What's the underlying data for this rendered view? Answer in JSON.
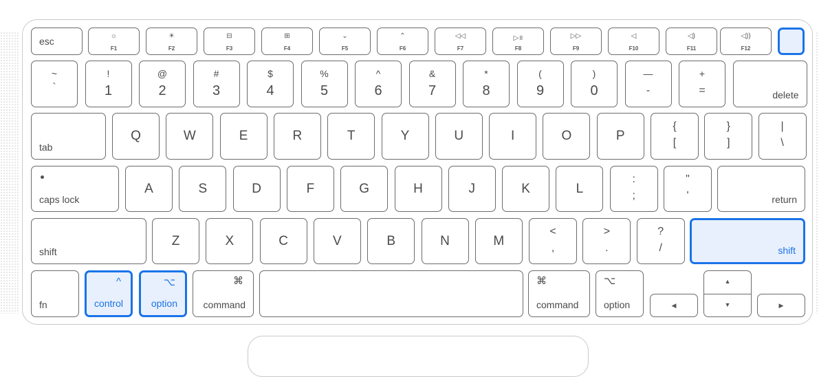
{
  "colors": {
    "accent": "#1a73e8",
    "accent_fill": "#e8f0fd",
    "key_border": "#6b6b6b",
    "text": "#4a4a4a"
  },
  "function_row": [
    {
      "id": "esc",
      "label": "esc"
    },
    {
      "id": "f1",
      "icon": "☼",
      "label": "F1",
      "icon_name": "brightness-down-icon"
    },
    {
      "id": "f2",
      "icon": "☀",
      "label": "F2",
      "icon_name": "brightness-up-icon"
    },
    {
      "id": "f3",
      "icon": "⊟",
      "label": "F3",
      "icon_name": "mission-control-icon"
    },
    {
      "id": "f4",
      "icon": "⊞",
      "label": "F4",
      "icon_name": "launchpad-icon"
    },
    {
      "id": "f5",
      "icon": "⌄",
      "label": "F5",
      "icon_name": "keyboard-backlight-down-icon"
    },
    {
      "id": "f6",
      "icon": "⌃",
      "label": "F6",
      "icon_name": "keyboard-backlight-up-icon"
    },
    {
      "id": "f7",
      "icon": "◁◁",
      "label": "F7",
      "icon_name": "rewind-icon"
    },
    {
      "id": "f8",
      "icon": "▷॥",
      "label": "F8",
      "icon_name": "play-pause-icon"
    },
    {
      "id": "f9",
      "icon": "▷▷",
      "label": "F9",
      "icon_name": "fast-forward-icon"
    },
    {
      "id": "f10",
      "icon": "◁",
      "label": "F10",
      "icon_name": "mute-icon"
    },
    {
      "id": "f11",
      "icon": "◁)",
      "label": "F11",
      "icon_name": "volume-down-icon"
    },
    {
      "id": "f12",
      "icon": "◁))",
      "label": "F12",
      "icon_name": "volume-up-icon"
    },
    {
      "id": "power",
      "label": "",
      "selected": true
    }
  ],
  "number_row": [
    {
      "top": "~",
      "bottom": "`"
    },
    {
      "top": "!",
      "bottom": "1"
    },
    {
      "top": "@",
      "bottom": "2"
    },
    {
      "top": "#",
      "bottom": "3"
    },
    {
      "top": "$",
      "bottom": "4"
    },
    {
      "top": "%",
      "bottom": "5"
    },
    {
      "top": "^",
      "bottom": "6"
    },
    {
      "top": "&",
      "bottom": "7"
    },
    {
      "top": "*",
      "bottom": "8"
    },
    {
      "top": "(",
      "bottom": "9"
    },
    {
      "top": ")",
      "bottom": "0"
    },
    {
      "top": "—",
      "bottom": "-"
    },
    {
      "top": "+",
      "bottom": "="
    },
    {
      "label": "delete"
    }
  ],
  "qwerty_row": {
    "tab": "tab",
    "letters": [
      "Q",
      "W",
      "E",
      "R",
      "T",
      "Y",
      "U",
      "I",
      "O",
      "P"
    ],
    "punct": [
      {
        "top": "{",
        "bottom": "["
      },
      {
        "top": "}",
        "bottom": "]"
      },
      {
        "top": "|",
        "bottom": "\\"
      }
    ]
  },
  "home_row": {
    "caps": "caps lock",
    "letters": [
      "A",
      "S",
      "D",
      "F",
      "G",
      "H",
      "J",
      "K",
      "L"
    ],
    "punct": [
      {
        "top": ":",
        "bottom": ";"
      },
      {
        "top": "\"",
        "bottom": "'"
      }
    ],
    "return": "return"
  },
  "bottom_letter_row": {
    "shift_left": "shift",
    "letters": [
      "Z",
      "X",
      "C",
      "V",
      "B",
      "N",
      "M"
    ],
    "punct": [
      {
        "top": "<",
        "bottom": ","
      },
      {
        "top": ">",
        "bottom": "."
      },
      {
        "top": "?",
        "bottom": "/"
      }
    ],
    "shift_right": "shift",
    "shift_right_selected": true
  },
  "modifier_row": {
    "fn": "fn",
    "control": {
      "symbol": "^",
      "label": "control",
      "selected": true
    },
    "option_left": {
      "symbol": "⌥",
      "label": "option",
      "selected": true
    },
    "command_left": {
      "symbol": "⌘",
      "label": "command"
    },
    "space": "",
    "command_right": {
      "symbol": "⌘",
      "label": "command"
    },
    "option_right": {
      "symbol": "⌥",
      "label": "option"
    },
    "arrows": {
      "left": "◀",
      "up": "▲",
      "down": "▼",
      "right": "▶"
    }
  }
}
